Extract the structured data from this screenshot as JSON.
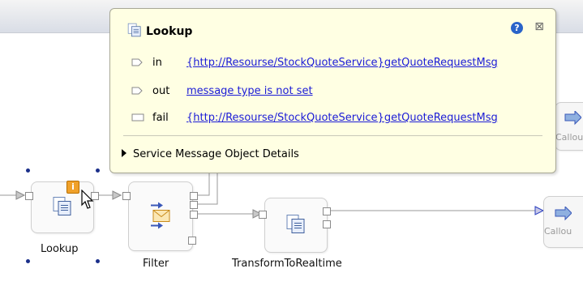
{
  "popup": {
    "title": "Lookup",
    "help_glyph": "?",
    "close_glyph": "⊠",
    "rows": [
      {
        "kind": "in",
        "link": "{http://Resourse/StockQuoteService}getQuoteRequestMsg"
      },
      {
        "kind": "out",
        "link": "message type is not set"
      },
      {
        "kind": "fail",
        "link": "{http://Resourse/StockQuoteService}getQuoteRequestMsg"
      }
    ],
    "details_label": "Service Message Object Details"
  },
  "nodes": {
    "lookup": {
      "label": "Lookup",
      "badge": "i"
    },
    "filter": {
      "label": "Filter"
    },
    "transform": {
      "label": "TransformToRealtime"
    },
    "callout_top": {
      "label": "Callou"
    },
    "callout_bottom": {
      "label": "Callou"
    }
  },
  "colors": {
    "popup_bg": "#ffffe3",
    "link": "#1b1bd6",
    "selection_handle": "#1b2f8a",
    "info_badge": "#f0a12a"
  }
}
